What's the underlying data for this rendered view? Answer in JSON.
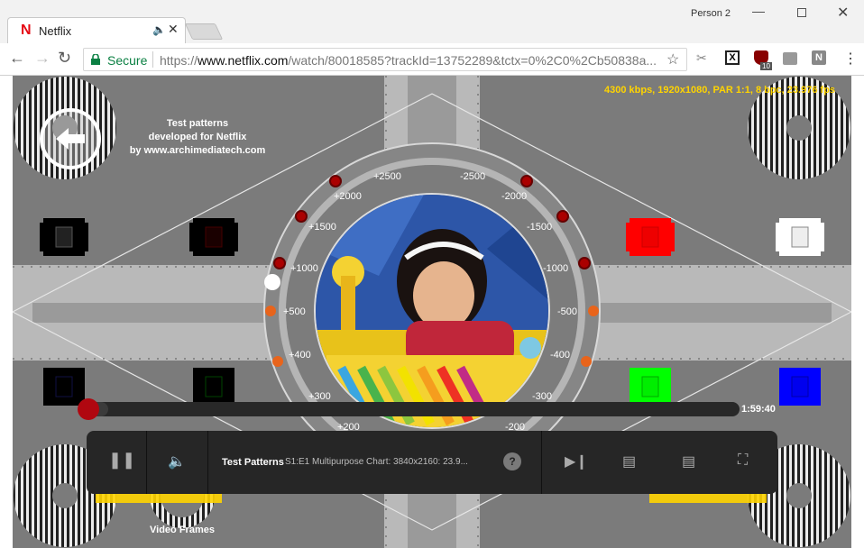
{
  "browser": {
    "tab_title": "Netflix",
    "tab_logo": "N",
    "profile_name": "Person 2",
    "secure_label": "Secure",
    "url_scheme": "https://",
    "url_host": "www.netflix.com",
    "url_path": "/watch/80018585?trackId=13752289&tctx=0%2C0%2Cb50838a...",
    "icons": [
      "back-arrow-icon",
      "forward-arrow-icon",
      "reload-icon",
      "lock-icon",
      "star-icon",
      "menu-icon"
    ],
    "extensions": {
      "ublock_badge": "10",
      "n_label": "N",
      "x_label": "X"
    }
  },
  "video": {
    "stream_info": "4300 kbps, 1920x1080, PAR 1:1, 8 bpc, 23.976 fps",
    "credit_lines": [
      "Test patterns",
      "developed for Netflix",
      "by www.archimediatech.com"
    ],
    "frames_label": "Video Frames",
    "dial_labels": {
      "p2500": "+2500",
      "m2500": "-2500",
      "p2000": "+2000",
      "m2000": "-2000",
      "p1500": "+1500",
      "m1500": "-1500",
      "p1000": "+1000",
      "m1000": "-1000",
      "p500": "+500",
      "m500": "-500",
      "p400": "+400",
      "m400": "-400",
      "p300": "+300",
      "m300": "-300",
      "p200": "+200",
      "m200": "-200"
    },
    "colors": {
      "red": "#ff0000",
      "green": "#00ff00",
      "blue": "#0000ff",
      "white": "#ffffff",
      "black": "#000000",
      "netflix_red": "#b00710",
      "info_yellow": "#ffd400"
    }
  },
  "player": {
    "progress_fraction": 0.03,
    "time_remaining": "1:59:40",
    "episode_title": "Test Patterns",
    "episode_desc": "S1:E1  Multipurpose Chart: 3840x2160: 23.9...",
    "help_label": "?"
  }
}
